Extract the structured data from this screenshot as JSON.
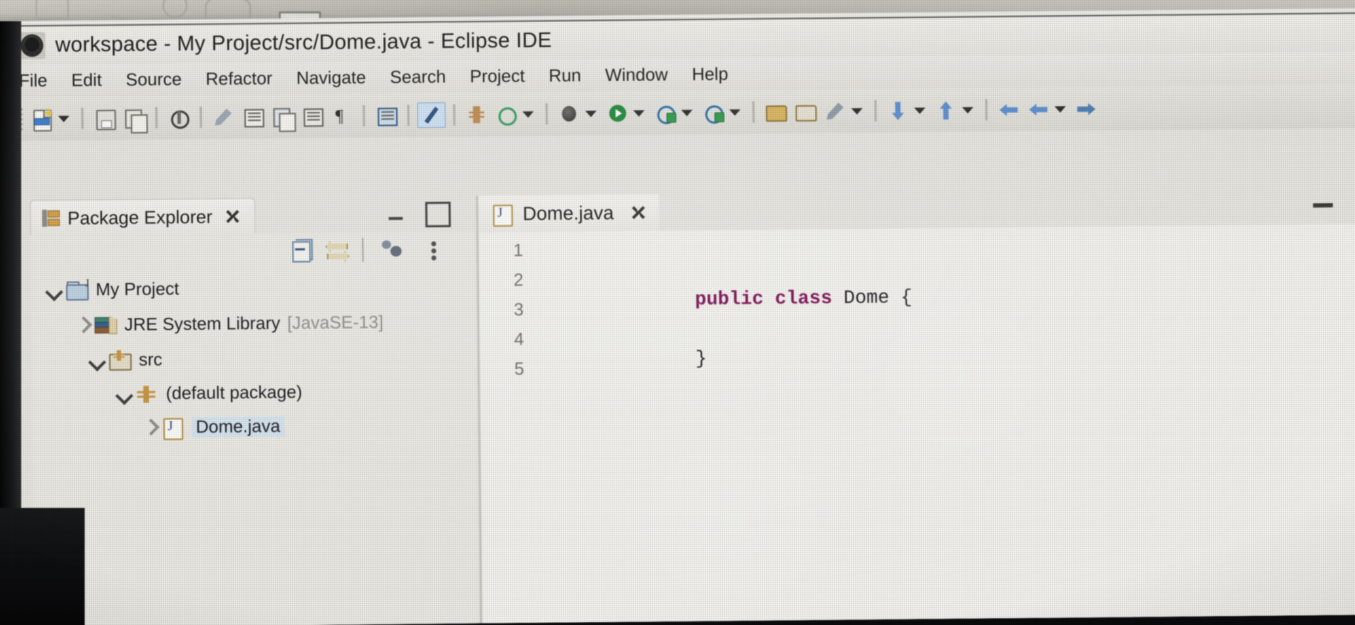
{
  "window": {
    "title": "workspace - My  Project/src/Dome.java - Eclipse IDE",
    "app_icon": "eclipse-icon"
  },
  "menubar": {
    "items": [
      {
        "label": "File"
      },
      {
        "label": "Edit"
      },
      {
        "label": "Source"
      },
      {
        "label": "Refactor"
      },
      {
        "label": "Navigate"
      },
      {
        "label": "Search"
      },
      {
        "label": "Project"
      },
      {
        "label": "Run"
      },
      {
        "label": "Window"
      },
      {
        "label": "Help"
      }
    ]
  },
  "toolbar": {
    "items": [
      {
        "name": "new-wizard-button",
        "icon": "new-file-icon"
      },
      {
        "name": "new-wizard-dropdown",
        "icon": "chevron-down-icon"
      },
      {
        "name": "save-button",
        "icon": "save-disk-icon"
      },
      {
        "name": "save-all-button",
        "icon": "save-all-icon"
      },
      {
        "name": "build-all-button",
        "icon": "hammer-icon"
      },
      {
        "name": "skip-breakpoints-button",
        "icon": "skip-breakpoints-icon"
      },
      {
        "name": "new-java-class-button",
        "icon": "new-class-icon"
      },
      {
        "name": "new-java-package-button",
        "icon": "new-package-icon"
      },
      {
        "name": "toggle-mark-occurrences-button",
        "icon": "mark-occurrences-icon"
      },
      {
        "name": "show-whitespace-button",
        "icon": "pilcrow-icon"
      },
      {
        "name": "open-task-button",
        "icon": "task-icon"
      },
      {
        "name": "toggle-breadcrumb-button",
        "icon": "breadcrumb-slash-icon"
      },
      {
        "name": "new-package-grid-button",
        "icon": "grid-icon"
      },
      {
        "name": "open-type-button",
        "icon": "open-type-icon"
      },
      {
        "name": "open-type-dropdown",
        "icon": "chevron-down-icon"
      },
      {
        "name": "debug-button",
        "icon": "bug-icon"
      },
      {
        "name": "debug-dropdown",
        "icon": "chevron-down-icon"
      },
      {
        "name": "run-button",
        "icon": "run-play-icon"
      },
      {
        "name": "run-dropdown",
        "icon": "chevron-down-icon"
      },
      {
        "name": "coverage-button",
        "icon": "coverage-icon"
      },
      {
        "name": "coverage-dropdown",
        "icon": "chevron-down-icon"
      },
      {
        "name": "external-tools-button",
        "icon": "external-tools-icon"
      },
      {
        "name": "external-tools-dropdown",
        "icon": "chevron-down-icon"
      },
      {
        "name": "open-folder-button",
        "icon": "folder-open-icon"
      },
      {
        "name": "open-folder2-button",
        "icon": "folder-icon"
      },
      {
        "name": "search-pen-button",
        "icon": "pen-icon"
      },
      {
        "name": "search-pen-dropdown",
        "icon": "chevron-down-icon"
      },
      {
        "name": "previous-annotation-button",
        "icon": "up-arrow-icon"
      },
      {
        "name": "previous-annotation-dropdown",
        "icon": "chevron-down-icon"
      },
      {
        "name": "next-annotation-button",
        "icon": "down-arrow-icon"
      },
      {
        "name": "next-annotation-dropdown",
        "icon": "chevron-down-icon"
      },
      {
        "name": "back-button",
        "icon": "back-arrow-icon"
      },
      {
        "name": "forward-button",
        "icon": "forward-arrow-icon"
      },
      {
        "name": "forward-dropdown",
        "icon": "chevron-down-icon"
      },
      {
        "name": "last-edit-button",
        "icon": "last-edit-icon"
      }
    ]
  },
  "package_explorer": {
    "tab_label": "Package Explorer",
    "tab_icon": "package-explorer-icon",
    "close_icon": "close-icon",
    "minimize_icon": "minimize-icon",
    "maximize_icon": "maximize-icon",
    "view_toolbar": [
      {
        "name": "collapse-all-button",
        "icon": "collapse-all-icon"
      },
      {
        "name": "link-with-editor-button",
        "icon": "link-editor-icon"
      },
      {
        "name": "view-menu-button",
        "icon": "view-presentation-icon"
      },
      {
        "name": "view-menu-dots-button",
        "icon": "vertical-dots-icon"
      }
    ],
    "tree": [
      {
        "label": "My  Project",
        "icon": "java-project-icon",
        "twisty": "expanded",
        "indent": 0,
        "selected": false
      },
      {
        "label": "JRE System Library",
        "suffix": "[JavaSE-13]",
        "icon": "jre-library-icon",
        "twisty": "collapsed",
        "indent": 1,
        "selected": false
      },
      {
        "label": "src",
        "icon": "source-folder-icon",
        "twisty": "expanded",
        "indent": 1,
        "selected": false
      },
      {
        "label": "(default package)",
        "icon": "package-icon",
        "twisty": "expanded",
        "indent": 2,
        "selected": false
      },
      {
        "label": "Dome.java",
        "icon": "java-file-icon",
        "twisty": "collapsed",
        "indent": 3,
        "selected": true
      }
    ]
  },
  "editor": {
    "tab_label": "Dome.java",
    "tab_icon": "java-file-icon",
    "close_icon": "close-icon",
    "maximize_icon": "maximize-icon",
    "line_numbers": [
      "1",
      "2",
      "3",
      "4",
      "5"
    ],
    "lines": [
      {
        "number": "1",
        "tokens": []
      },
      {
        "number": "2",
        "tokens": [
          {
            "text": "public class ",
            "type": "keyword"
          },
          {
            "text": "Dome {",
            "type": "plain"
          }
        ]
      },
      {
        "number": "3",
        "tokens": []
      },
      {
        "number": "4",
        "tokens": [
          {
            "text": "}",
            "type": "plain"
          }
        ]
      },
      {
        "number": "5",
        "tokens": []
      }
    ]
  },
  "colors": {
    "keyword": "#7a0b52",
    "selection": "#d6e5f0",
    "chrome": "#efeeea",
    "editor_bg": "#f4f3ef"
  }
}
